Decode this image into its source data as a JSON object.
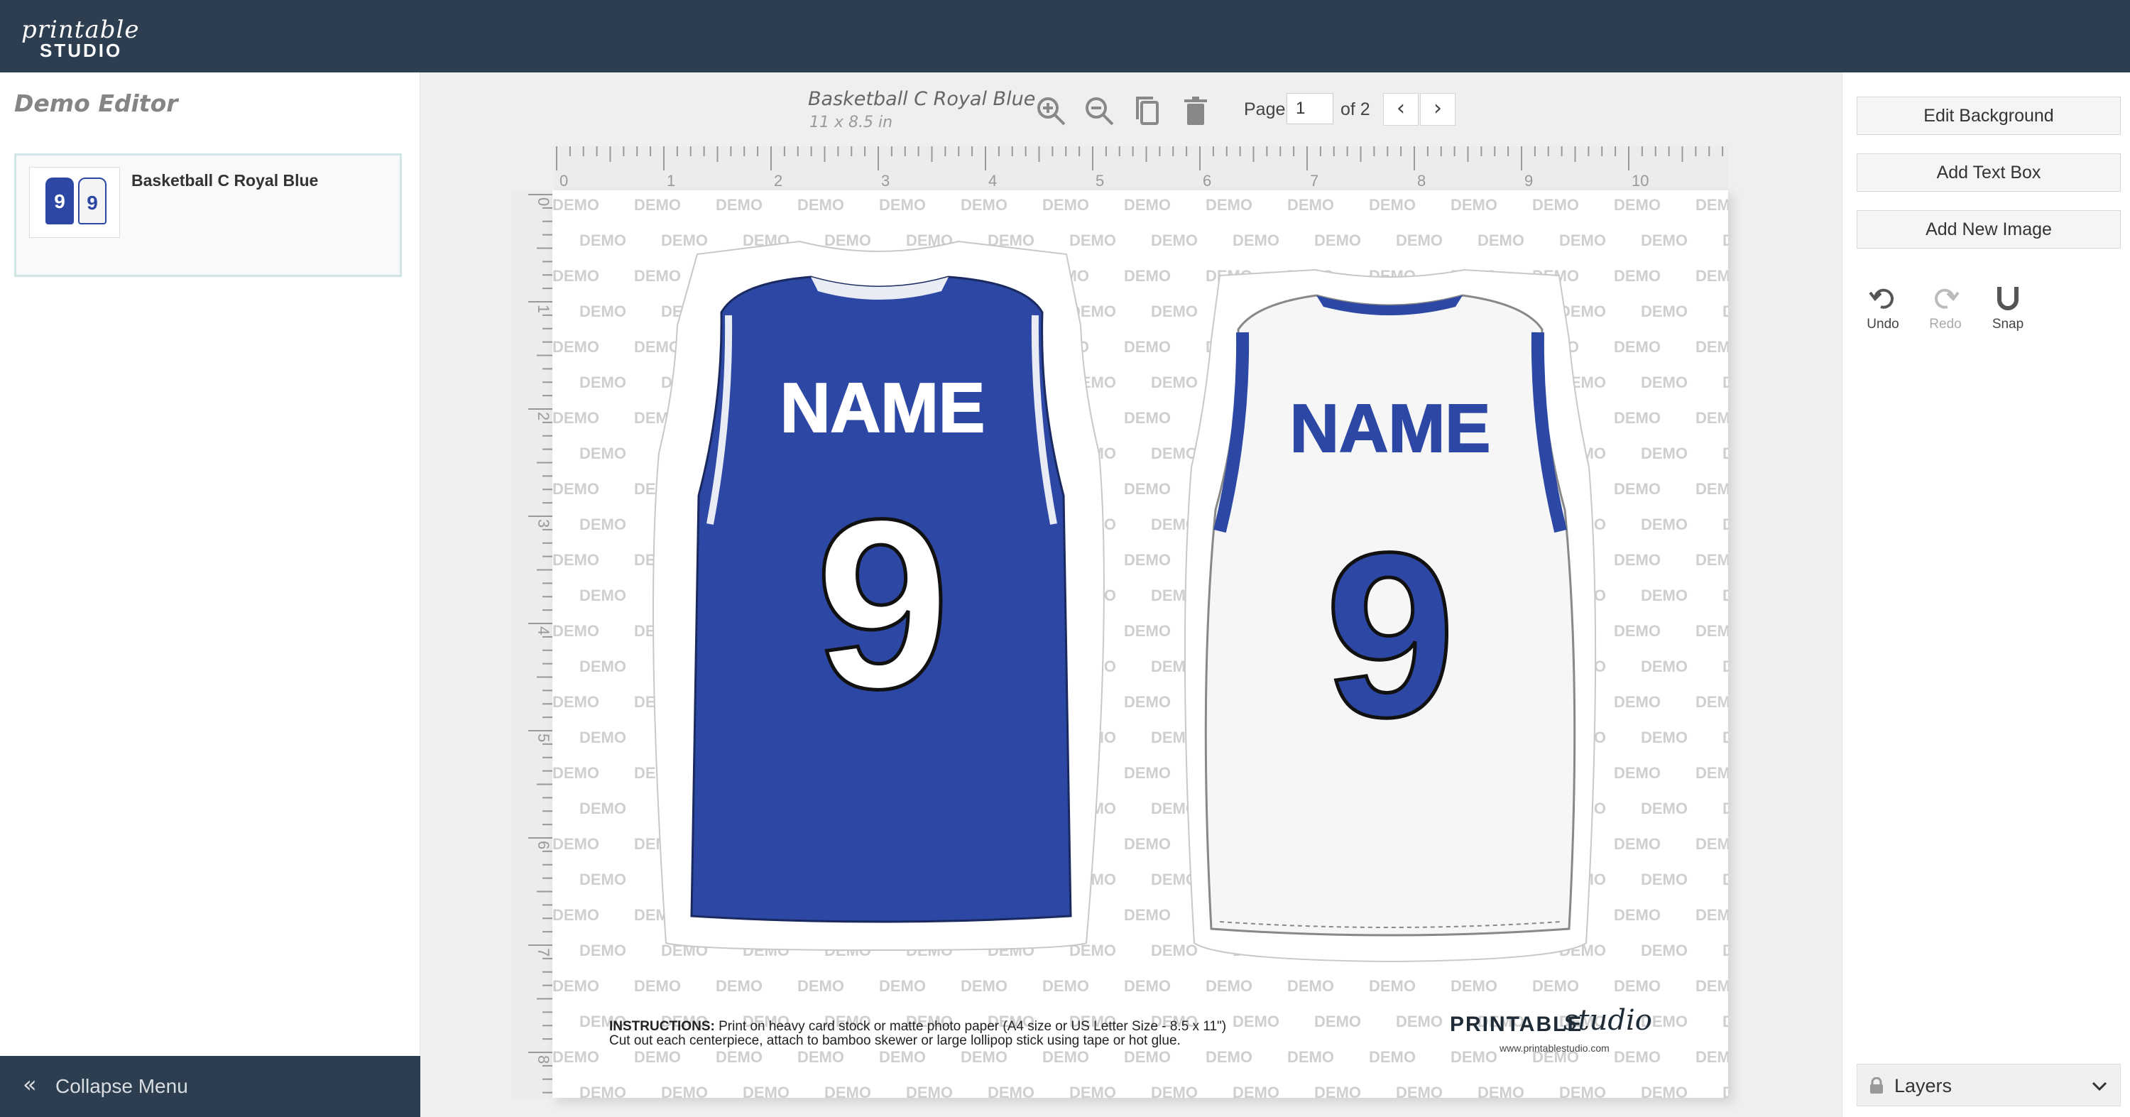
{
  "app": {
    "logo_script": "printable",
    "logo_word": "STUDIO"
  },
  "left_panel": {
    "title": "Demo Editor",
    "product": {
      "name": "Basketball C Royal Blue",
      "thumb_numbers": [
        "9",
        "9"
      ]
    },
    "collapse_label": "Collapse Menu"
  },
  "document": {
    "title": "Basketball C Royal Blue",
    "size": "11 x 8.5 in",
    "page_label": "Page",
    "page_value": "1",
    "page_of": "of 2"
  },
  "toolbar": {
    "icons": [
      "zoom-in-icon",
      "zoom-out-icon",
      "copy-icon",
      "trash-icon",
      "chevron-left-icon",
      "chevron-right-icon"
    ],
    "prev": "‹",
    "next": "›"
  },
  "ruler": {
    "horizontal_labels": [
      "0",
      "1",
      "2",
      "3",
      "4",
      "5",
      "6",
      "7",
      "8",
      "9",
      "10"
    ],
    "vertical_labels": [
      "0",
      "1",
      "2",
      "3",
      "4",
      "5",
      "6",
      "7",
      "8"
    ]
  },
  "artboard": {
    "watermark": "DEMO",
    "jersey_front": {
      "name": "NAME",
      "number": "9",
      "color": "#2c48a4"
    },
    "jersey_back": {
      "name": "NAME",
      "number": "9",
      "color": "#2c48a4"
    },
    "instructions_label": "INSTRUCTIONS:",
    "instructions_line1": "Print on heavy card stock or matte photo paper (A4 size or US Letter Size - 8.5 x 11\")",
    "instructions_line2": "Cut out each centerpiece, attach to bamboo skewer or large lollipop stick using tape or hot glue.",
    "brand_main": "PRINTABLE",
    "brand_script": "studio",
    "brand_url": "www.printablestudio.com"
  },
  "right_panel": {
    "edit_background": "Edit Background",
    "add_text_box": "Add Text Box",
    "add_new_image": "Add New Image",
    "undo": "Undo",
    "redo": "Redo",
    "snap": "Snap",
    "layers": "Layers"
  },
  "colors": {
    "topbar": "#2c3e50",
    "jersey_blue": "#2c48a4",
    "accent_border": "#cfe6e4"
  }
}
